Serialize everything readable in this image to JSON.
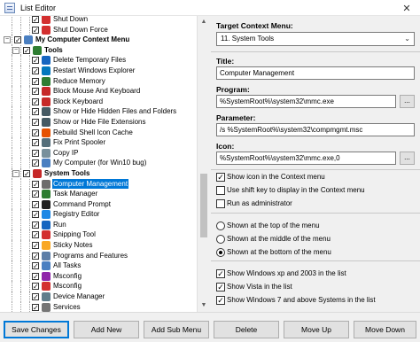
{
  "window": {
    "title": "List Editor",
    "close_glyph": "✕"
  },
  "tree": {
    "items": [
      {
        "label": "Shut Down",
        "bold": false,
        "checked": true,
        "icon": "shutdown-icon",
        "color": "#d32f2f"
      },
      {
        "label": "Shut Down Force",
        "bold": false,
        "checked": true,
        "icon": "shutdown-force-icon",
        "color": "#d32f2f"
      },
      {
        "label": "My Computer Context Menu",
        "bold": true,
        "checked": true,
        "icon": "computer-icon",
        "color": "#4a7fc1"
      },
      {
        "label": "Tools",
        "bold": true,
        "checked": true,
        "icon": "tools-icon",
        "color": "#2e7d32"
      },
      {
        "label": "Delete Temporary Files",
        "bold": false,
        "checked": true,
        "icon": "delete-icon",
        "color": "#1565c0"
      },
      {
        "label": "Restart Windows Explorer",
        "bold": false,
        "checked": true,
        "icon": "restart-icon",
        "color": "#0277bd"
      },
      {
        "label": "Reduce Memory",
        "bold": false,
        "checked": true,
        "icon": "memory-icon",
        "color": "#2e7d32"
      },
      {
        "label": "Block Mouse And Keyboard",
        "bold": false,
        "checked": true,
        "icon": "block-mouse-icon",
        "color": "#c62828"
      },
      {
        "label": "Block Keyboard",
        "bold": false,
        "checked": true,
        "icon": "block-keyboard-icon",
        "color": "#c62828"
      },
      {
        "label": "Show or Hide Hidden Files and Folders",
        "bold": false,
        "checked": true,
        "icon": "eye-icon",
        "color": "#455a64"
      },
      {
        "label": "Show or Hide File Extensions",
        "bold": false,
        "checked": true,
        "icon": "eye-icon",
        "color": "#455a64"
      },
      {
        "label": "Rebuild Shell Icon Cache",
        "bold": false,
        "checked": true,
        "icon": "rebuild-icon",
        "color": "#e65100"
      },
      {
        "label": "Fix Print Spooler",
        "bold": false,
        "checked": true,
        "icon": "printer-icon",
        "color": "#546e7a"
      },
      {
        "label": "Copy IP",
        "bold": false,
        "checked": true,
        "icon": "copy-icon",
        "color": "#78909c"
      },
      {
        "label": "My Computer (for Win10 bug)",
        "bold": false,
        "checked": true,
        "icon": "computer-icon",
        "color": "#4a7fc1"
      },
      {
        "label": "System Tools",
        "bold": true,
        "checked": true,
        "icon": "system-tools-icon",
        "color": "#c62828"
      },
      {
        "label": "Computer Management",
        "bold": false,
        "checked": true,
        "selected": true,
        "icon": "management-icon",
        "color": "#6d6d6d"
      },
      {
        "label": "Task Manager",
        "bold": false,
        "checked": true,
        "icon": "task-manager-icon",
        "color": "#2e7d32"
      },
      {
        "label": "Command Prompt",
        "bold": false,
        "checked": true,
        "icon": "cmd-icon",
        "color": "#212121"
      },
      {
        "label": "Registry Editor",
        "bold": false,
        "checked": true,
        "icon": "registry-icon",
        "color": "#1e88e5"
      },
      {
        "label": "Run",
        "bold": false,
        "checked": true,
        "icon": "run-icon",
        "color": "#1565c0"
      },
      {
        "label": "Snipping Tool",
        "bold": false,
        "checked": true,
        "icon": "scissors-icon",
        "color": "#d32f2f"
      },
      {
        "label": "Sticky Notes",
        "bold": false,
        "checked": true,
        "icon": "note-icon",
        "color": "#f9a825"
      },
      {
        "label": "Programs and Features",
        "bold": false,
        "checked": true,
        "icon": "programs-icon",
        "color": "#5d7ea8"
      },
      {
        "label": "All Tasks",
        "bold": false,
        "checked": true,
        "icon": "all-tasks-icon",
        "color": "#4a7fc1"
      },
      {
        "label": "Msconfig",
        "bold": false,
        "checked": true,
        "icon": "msconfig-icon",
        "color": "#8e24aa"
      },
      {
        "label": "Msconfig",
        "bold": false,
        "checked": true,
        "icon": "msconfig-red-icon",
        "color": "#d32f2f"
      },
      {
        "label": "Device Manager",
        "bold": false,
        "checked": true,
        "icon": "device-manager-icon",
        "color": "#607d8b"
      },
      {
        "label": "Services",
        "bold": false,
        "checked": true,
        "icon": "services-icon",
        "color": "#757575"
      }
    ]
  },
  "panel": {
    "target_label": "Target Context Menu:",
    "target_value": "11. System Tools",
    "title_label": "Title:",
    "title_value": "Computer Management",
    "program_label": "Program:",
    "program_value": "%SystemRoot%\\system32\\mmc.exe",
    "parameter_label": "Parameter:",
    "parameter_value": "/s %SystemRoot%\\system32\\compmgmt.msc",
    "icon_label": "Icon:",
    "icon_value": "%SystemRoot%\\system32\\mmc.exe,0",
    "browse_label": "...",
    "checks1": [
      {
        "label": "Show icon in the Context menu",
        "checked": true
      },
      {
        "label": "Use shift key to display in the Context menu",
        "checked": false
      },
      {
        "label": "Run as administrator",
        "checked": false
      }
    ],
    "radios": [
      {
        "label": "Shown at the top of the menu",
        "selected": false
      },
      {
        "label": "Shown at the middle of the menu",
        "selected": false
      },
      {
        "label": "Shown at the bottom of the menu",
        "selected": true
      }
    ],
    "checks2": [
      {
        "label": "Show Windows xp  and 2003 in the list",
        "checked": true
      },
      {
        "label": "Show Vista in the list",
        "checked": true
      },
      {
        "label": "Show Windows 7 and above Systems in the list",
        "checked": true
      }
    ]
  },
  "buttons": {
    "save": "Save Changes",
    "add_new": "Add New",
    "add_sub": "Add Sub Menu",
    "delete": "Delete",
    "move_up": "Move Up",
    "move_down": "Move Down"
  }
}
